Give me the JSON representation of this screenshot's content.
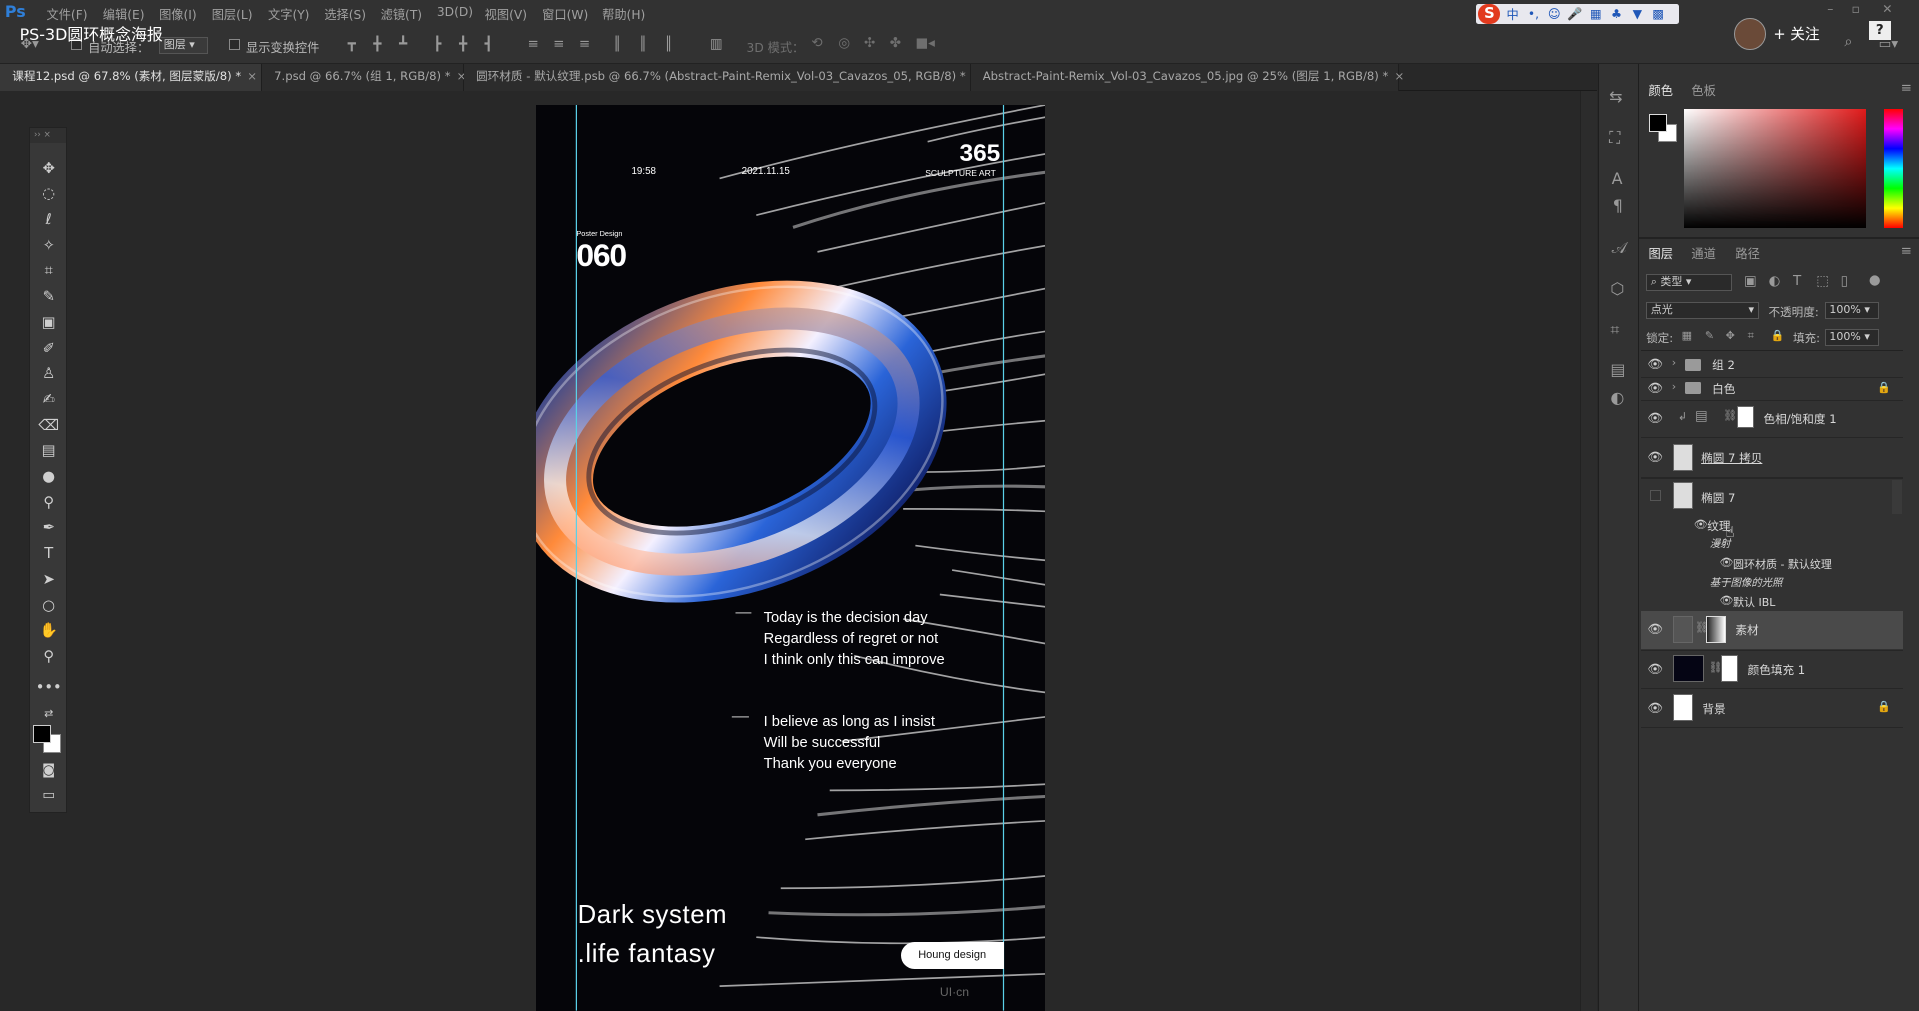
{
  "video_title": "PS-3D圆环概念海报",
  "menu": [
    "文件(F)",
    "编辑(E)",
    "图像(I)",
    "图层(L)",
    "文字(Y)",
    "选择(S)",
    "滤镜(T)",
    "3D(D)",
    "视图(V)",
    "窗口(W)",
    "帮助(H)"
  ],
  "options_bar": {
    "auto_select_label": "自动选择：",
    "auto_select_value": "图层",
    "show_transform_label": "显示变换控件",
    "mode_3d_label": "3D 模式："
  },
  "header_right": {
    "follow_label": "+ 关注",
    "help_label": "?"
  },
  "tabs": [
    {
      "label": "课程12.psd @ 67.8% (素材, 图层蒙版/8) *",
      "close": "×",
      "active": true
    },
    {
      "label": "7.psd @ 66.7% (组 1, RGB/8) *",
      "close": "×",
      "active": false
    },
    {
      "label": "圆环材质 - 默认纹理.psb @ 66.7% (Abstract-Paint-Remix_Vol-03_Cavazos_05, RGB/8) *",
      "close": "×",
      "active": false
    },
    {
      "label": "Abstract-Paint-Remix_Vol-03_Cavazos_05.jpg @ 25% (图层 1, RGB/8) *",
      "close": "×",
      "active": false
    }
  ],
  "poster": {
    "time": "19:58",
    "date": "2021.11.15",
    "badge_number": "365",
    "badge_sub": "SCULPTURE ART",
    "small_label": "Poster Design",
    "big_number": "060",
    "para1": [
      "Today is the decision day",
      "Regardless of regret or not",
      "I think only this can improve"
    ],
    "para2": [
      "I believe as long as I insist",
      "Will be successful",
      "Thank you everyone"
    ],
    "headline1": "Dark system",
    "headline2": ".life fantasy",
    "pill": "Houng design",
    "watermark": "UI·cn"
  },
  "color_panel": {
    "tabs": [
      "颜色",
      "色板"
    ],
    "foreground": "#000000",
    "background": "#ffffff"
  },
  "layers_panel": {
    "tabs": [
      "图层",
      "通道",
      "路径"
    ],
    "filter_kind": "类型",
    "blend_mode": "点光",
    "opacity_label": "不透明度:",
    "opacity_value": "100%",
    "lock_label": "锁定:",
    "fill_label": "填充:",
    "fill_value": "100%",
    "layers": [
      {
        "name": "组 2",
        "kind": "group"
      },
      {
        "name": "白色",
        "kind": "group",
        "locked": true
      },
      {
        "name": "色相/饱和度 1",
        "kind": "adjustment"
      },
      {
        "name": "椭圆 7 拷贝",
        "kind": "3d"
      },
      {
        "name": "椭圆 7",
        "kind": "3d"
      },
      {
        "name": "纹理",
        "kind": "sub"
      },
      {
        "name": "漫射",
        "kind": "sub-italic"
      },
      {
        "name": "圆环材质 - 默认纹理",
        "kind": "subsub"
      },
      {
        "name": "基于图像的光照",
        "kind": "sub-italic"
      },
      {
        "name": "默认 IBL",
        "kind": "subsub"
      },
      {
        "name": "素材",
        "kind": "masked",
        "selected": true
      },
      {
        "name": "颜色填充 1",
        "kind": "fill"
      },
      {
        "name": "背景",
        "kind": "background",
        "locked": true
      }
    ]
  },
  "accent_colors": {
    "ps_blue": "#2f7fd8",
    "guide_cyan": "#5ad0e8",
    "selected_row": "#4a4a4a"
  }
}
